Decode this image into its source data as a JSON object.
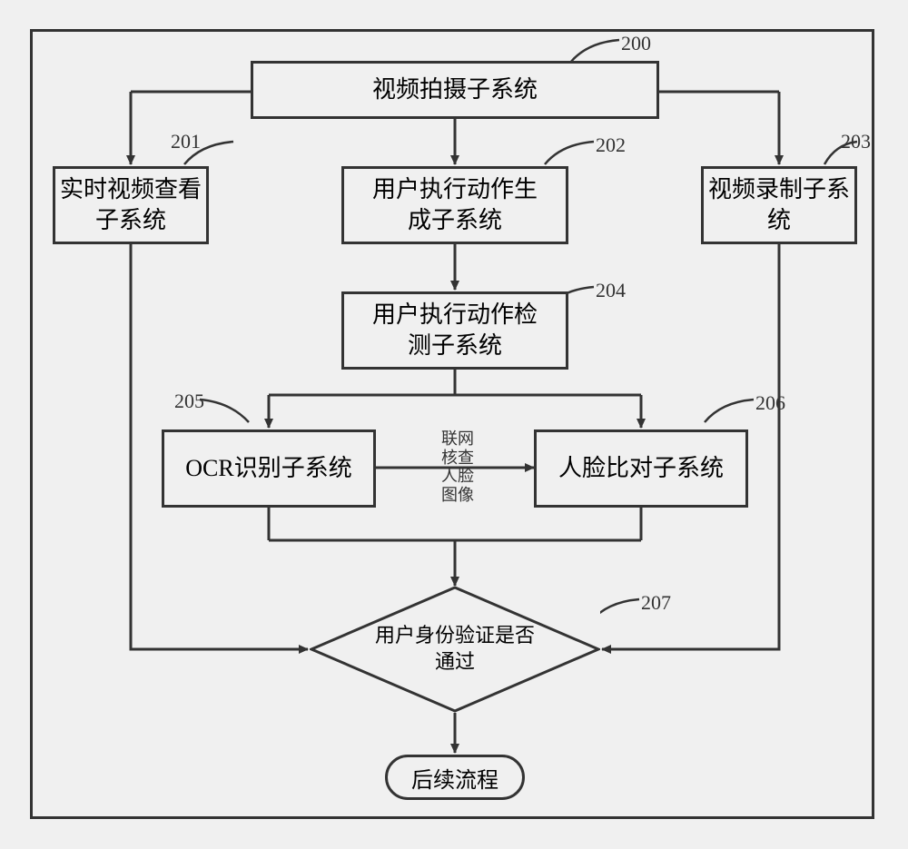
{
  "nodes": {
    "n200": {
      "ref": "200",
      "label": "视频拍摄子系统"
    },
    "n201": {
      "ref": "201",
      "label": "实时视频查看\n子系统"
    },
    "n202": {
      "ref": "202",
      "label": "用户执行动作生\n成子系统"
    },
    "n203": {
      "ref": "203",
      "label": "视频录制子系\n统"
    },
    "n204": {
      "ref": "204",
      "label": "用户执行动作检\n测子系统"
    },
    "n205": {
      "ref": "205",
      "label": "OCR识别子系统"
    },
    "n206": {
      "ref": "206",
      "label": "人脸比对子系统"
    },
    "n207": {
      "ref": "207",
      "label": "用户身份验证是否\n通过"
    },
    "terminal": {
      "label": "后续流程"
    }
  },
  "edge_label": "联网\n核查\n人脸\n图像"
}
